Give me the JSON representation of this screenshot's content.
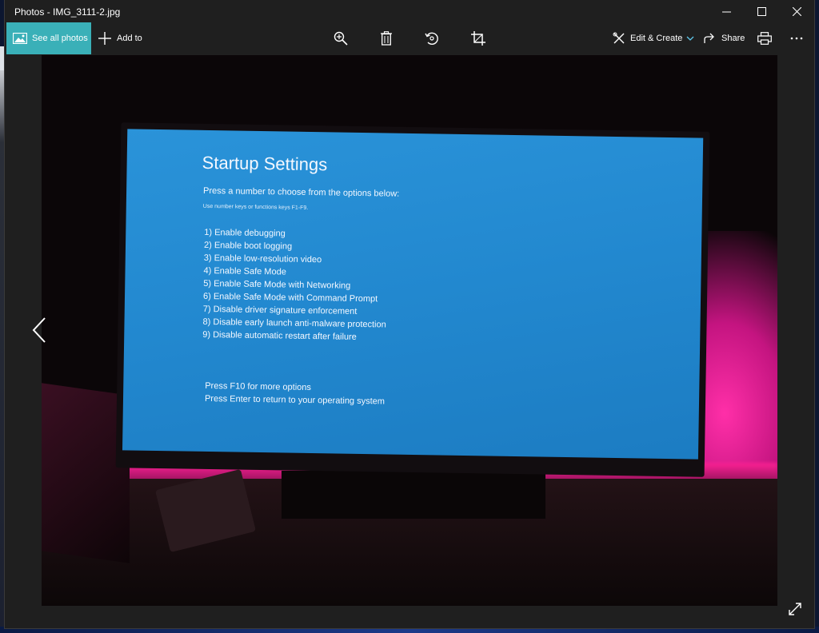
{
  "window": {
    "title": "Photos - IMG_3111-2.jpg",
    "controls": [
      "minimize-icon",
      "maximize-icon",
      "close-icon"
    ]
  },
  "toolbar": {
    "see_all_photos": "See all photos",
    "add_to": "Add to",
    "center_icons": [
      "zoom-in-icon",
      "delete-icon",
      "rotate-icon",
      "crop-icon"
    ],
    "edit_create": "Edit & Create",
    "share": "Share",
    "accent_color": "#3ab0b8"
  },
  "photo": {
    "screen_title": "Startup Settings",
    "prompt": "Press a number to choose from the options below:",
    "note": "Use number keys or functions keys F1-F9.",
    "options": [
      "1) Enable debugging",
      "2) Enable boot logging",
      "3) Enable low-resolution video",
      "4) Enable Safe Mode",
      "5) Enable Safe Mode with Networking",
      "6) Enable Safe Mode with Command Prompt",
      "7) Disable driver signature enforcement",
      "8) Disable early launch anti-malware protection",
      "9) Disable automatic restart after failure"
    ],
    "footer": [
      "Press F10 for more options",
      "Press Enter to return to your operating system"
    ]
  }
}
